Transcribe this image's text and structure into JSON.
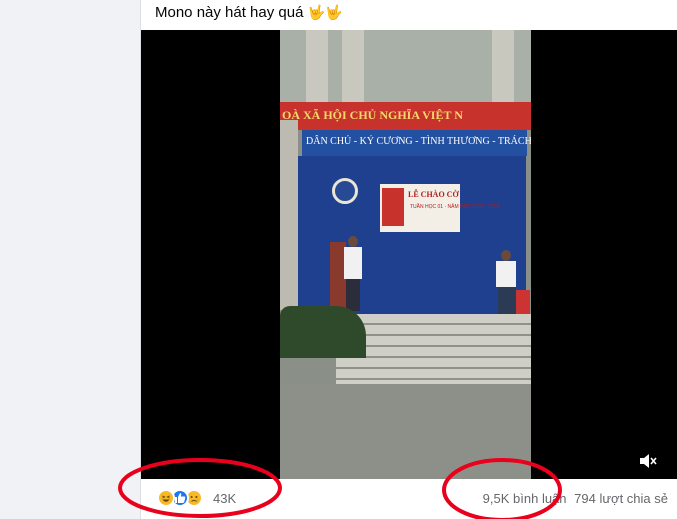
{
  "post": {
    "caption": "Mono này hát hay quá",
    "caption_emoji": "🤟🤟"
  },
  "video": {
    "banner_red_text": "OÀ XÃ HỘI CHỦ NGHĨA VIỆT N",
    "banner_blue_text": "DÂN CHỦ - KỶ CƯƠNG - TÌNH THƯƠNG - TRÁCH NHIỆM",
    "board_title": "LỄ CHÀO CỜ",
    "board_subtitle": "TUẦN HỌC 01 · NĂM HỌC 2022 - 2023",
    "mute_icon": "volume-muted-icon"
  },
  "footer": {
    "reactions": [
      {
        "name": "haha",
        "color": "#f7b928",
        "glyph": "😆"
      },
      {
        "name": "like",
        "color": "#1877f2",
        "glyph": "👍"
      },
      {
        "name": "sad",
        "color": "#f7b928",
        "glyph": "😢"
      }
    ],
    "reaction_count": "43K",
    "comments": "9,5K bình luận",
    "shares": "794 lượt chia sẻ"
  },
  "colors": {
    "annotation_red": "#e8001c",
    "secondary_text": "#65676b"
  }
}
